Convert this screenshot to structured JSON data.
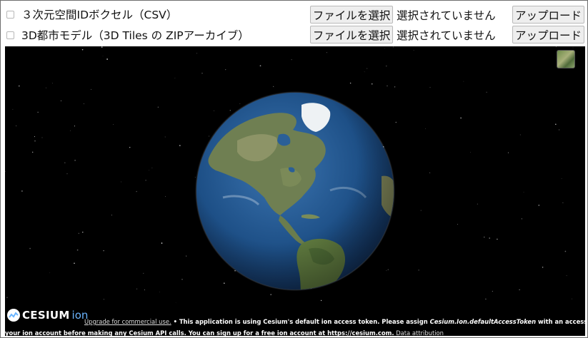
{
  "rows": [
    {
      "label": "３次元空間IDボクセル（CSV）",
      "file_button": "ファイルを選択",
      "no_file_text": "選択されていません",
      "upload_button": "アップロード"
    },
    {
      "label": "3D都市モデル（3D Tiles の ZIPアーカイブ）",
      "file_button": "ファイルを選択",
      "no_file_text": "選択されていません",
      "upload_button": "アップロード"
    }
  ],
  "viewer": {
    "logo_text": "CESIUM",
    "logo_ion": "ion",
    "upgrade_link": "Upgrade for commercial use.",
    "credit_line1": " • This application is using Cesium's default ion access token. Please assign ",
    "token_var": "Cesium.Ion.defaultAccessToken",
    "credit_line1b": " with an access token from",
    "credit_line2": "your ion account before making any Cesium API calls. You can sign up for a free ion account at https://cesium.com.",
    "data_attribution": "Data attribution",
    "colors": {
      "space": "#000000",
      "ocean": "#1d4f86",
      "land": "#6f7f52",
      "ion_blue": "#6bb5ff"
    }
  }
}
